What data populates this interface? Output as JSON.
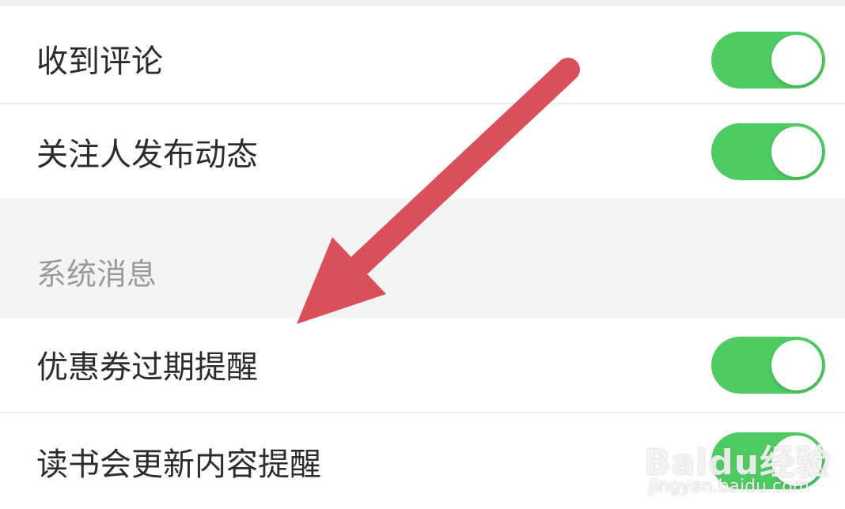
{
  "colors": {
    "toggle_on": "#4ecb61",
    "arrow": "#d9505a",
    "section_bg": "#f4f4f4",
    "row_bg": "#ffffff"
  },
  "settings": {
    "interaction_items": [
      {
        "label": "收到评论",
        "enabled": true
      },
      {
        "label": "关注人发布动态",
        "enabled": true
      }
    ],
    "system_section": {
      "title": "系统消息",
      "items": [
        {
          "label": "优惠券过期提醒",
          "enabled": true
        },
        {
          "label": "读书会更新内容提醒",
          "enabled": true
        }
      ]
    }
  },
  "watermark": {
    "logo": "Baidu经验",
    "url": "jingyan.baidu.com"
  }
}
